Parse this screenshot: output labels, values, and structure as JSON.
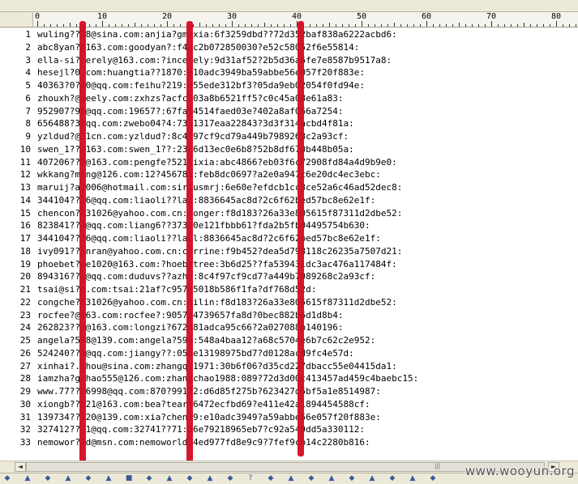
{
  "ruler": {
    "labels": [
      "0",
      "10",
      "20",
      "30",
      "40",
      "50",
      "60",
      "70",
      "80"
    ]
  },
  "editor": {
    "lines": [
      {
        "n": "1",
        "text": "wuling??28@sina.com:anjia?gmoxia:6f3259dbd??72d352baf838a6222acbd6:"
      },
      {
        "n": "2",
        "text": "abc8yan?@163.com:goodyan?:f4ac2b072850030?e52c58052f6e55814:"
      },
      {
        "n": "3",
        "text": "ella-si?cerely@163.com:?incerely:9d31af52?2b5d36a6fe7e8587b9517a8:"
      },
      {
        "n": "4",
        "text": "hesejl?0.com:huangtia??1870:e10adc3949ba59abbe56e057f20f883e:"
      },
      {
        "n": "5",
        "text": "40363?0?10@qq.com:feihu?219:055ede312bf3?05da9eb02054f0fd94e:"
      },
      {
        "n": "6",
        "text": "zhouxh?@geely.com:zxhzs?acfc903a8b6521ff5?c0c45a08e61a83:"
      },
      {
        "n": "7",
        "text": "952907?98@qq.com:19657?:67fa14514faed03e?402a8af066a7254:"
      },
      {
        "n": "8",
        "text": "656488?3@qq.com:zwebo04?4:7331317eaa22843?3d3f314acbd4f81a:"
      },
      {
        "n": "9",
        "text": "yzldud?@21cn.com:yzldud?:8c4f97cf9cd79a449b7989268c2a93cf:"
      },
      {
        "n": "10",
        "text": "swen_1??@163.com:swen_1??:2366d13ec0e6b8?52b8df670b448b05a:"
      },
      {
        "n": "11",
        "text": "407206??0@163.com:pengfe?521lixia:abc4866?eb03f6c72908fd84a4d9b9e0:"
      },
      {
        "n": "12",
        "text": "wkkang?ming@126.com:12?456781:feb8dc0697?a2e0a947c6e20dc4ec3ebc:"
      },
      {
        "n": "13",
        "text": "maruij?a2006@hotmail.com:siriusmrj:6e60e?efdcb1cc3ce52a6c46ad52dec8:"
      },
      {
        "n": "14",
        "text": "344104??26@qq.com:liaoli??lai:8836645ac8d?2c6f62bed57bc8e62e1f:"
      },
      {
        "n": "15",
        "text": "chencon?831026@yahoo.com.cn:conger:f8d183?26a33e805615f87311d2dbe52:"
      },
      {
        "n": "16",
        "text": "823841??4@qq.com:liang6??373:0e121fbbb61?fda2b5fb04495754b630:"
      },
      {
        "n": "17",
        "text": "344104??26@qq.com:liaoli??lail:8836645ac8d?2c6f62bed57bc8e62e1f:"
      },
      {
        "n": "18",
        "text": "ivy091??anran@yahoo.com.cn:corrine:f9b452?dea5d798118c26235a7507d21:"
      },
      {
        "n": "19",
        "text": "phoebet?ee1020@163.com:?hoebetree:3b6d25??fa539431dc3ac476a117484f:"
      },
      {
        "n": "20",
        "text": "894316??2@qq.com:duduvs??azhu:8c4f97cf9cd7?a449b7989268c2a93cf:"
      },
      {
        "n": "21",
        "text": "tsai@si?a.com:tsai:21af?c957e5018b586f1fa?df768d52d:"
      },
      {
        "n": "22",
        "text": "congche?831026@yahoo.com.cn:qilin:f8d183?26a33e805615f87311d2dbe52:"
      },
      {
        "n": "23",
        "text": "rocfee?@163.com:rocfee?:9057b4739657fa8d?0bec882b6d1d8b4:"
      },
      {
        "n": "24",
        "text": "262823??3@163.com:longzi?672481adca95c66?2a027088b140196:"
      },
      {
        "n": "25",
        "text": "angela?598@139.com:angela?598:548a4baa12?a68c5704e6b7c62c2e952:"
      },
      {
        "n": "26",
        "text": "524240??1@qq.com:jiangy??:05ae13198975bd7?d0128acd9fc4e57d:"
      },
      {
        "n": "27",
        "text": "xinhai?.zhou@sina.com:zhangqi1971:30b6f06?d35cd227dbacc55e04415da1:"
      },
      {
        "n": "28",
        "text": "iamzha?gchao555@126.com:zhangchao1988:089?72d3d00c413457ad459c4baebc15:"
      },
      {
        "n": "29",
        "text": "www.77??96998@qq.com:870?99122:d6d85f275b?623427d5bf5a1e8514987:"
      },
      {
        "n": "30",
        "text": "xiongb??521@163.com:bea?tear:6472ecfbd69?e411e42a1894454588cf:"
      },
      {
        "n": "31",
        "text": "139734??520@139.com:xia?chen19:e10adc3949?a59abbe56e057f20f883e:"
      },
      {
        "n": "32",
        "text": "327412??71@qq.com:32741??71:96e79218965eb7?c92a549dd5a330112:"
      },
      {
        "n": "33",
        "text": "nemowor??d@msn.com:nemoworld:4ed977fd8e9c9?7fef9cb14c2280b816:"
      }
    ]
  },
  "watermark": "www.wooyun.org",
  "colors": {
    "redaction": "#d40c22",
    "chrome": "#ece9d8"
  }
}
